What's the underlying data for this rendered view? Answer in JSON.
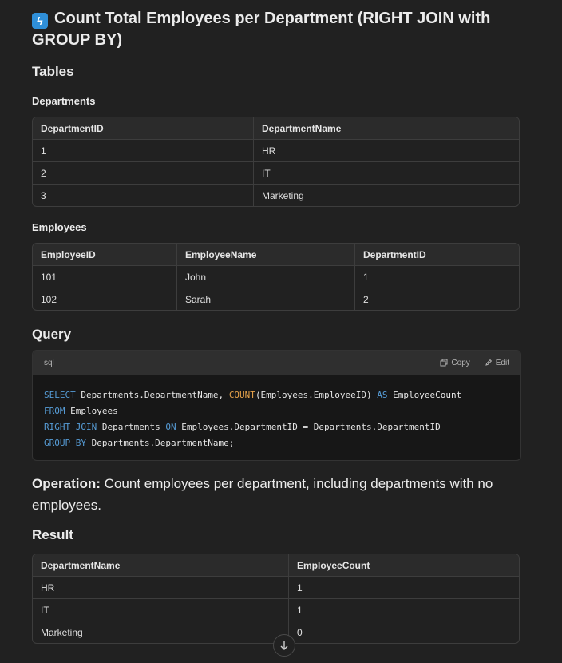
{
  "title": "Count Total Employees per Department (RIGHT JOIN with GROUP BY)",
  "title_icon": "lightning-icon",
  "tables_heading": "Tables",
  "departments": {
    "heading": "Departments",
    "columns": [
      "DepartmentID",
      "DepartmentName"
    ],
    "rows": [
      [
        "1",
        "HR"
      ],
      [
        "2",
        "IT"
      ],
      [
        "3",
        "Marketing"
      ]
    ]
  },
  "employees": {
    "heading": "Employees",
    "columns": [
      "EmployeeID",
      "EmployeeName",
      "DepartmentID"
    ],
    "rows": [
      [
        "101",
        "John",
        "1"
      ],
      [
        "102",
        "Sarah",
        "2"
      ]
    ]
  },
  "query": {
    "heading": "Query",
    "language": "sql",
    "copy_label": "Copy",
    "edit_label": "Edit",
    "lines": [
      "SELECT Departments.DepartmentName, COUNT(Employees.EmployeeID) AS EmployeeCount",
      "FROM Employees",
      "RIGHT JOIN Departments ON Employees.DepartmentID = Departments.DepartmentID",
      "GROUP BY Departments.DepartmentName;"
    ]
  },
  "operation": {
    "label": "Operation:",
    "text": " Count employees per department, including departments with no employees."
  },
  "result": {
    "heading": "Result",
    "columns": [
      "DepartmentName",
      "EmployeeCount"
    ],
    "rows": [
      [
        "HR",
        "1"
      ],
      [
        "IT",
        "1"
      ],
      [
        "Marketing",
        "0"
      ]
    ]
  },
  "colors": {
    "keyword": "#569cd6",
    "function": "#e6a24a",
    "background": "#212121"
  }
}
